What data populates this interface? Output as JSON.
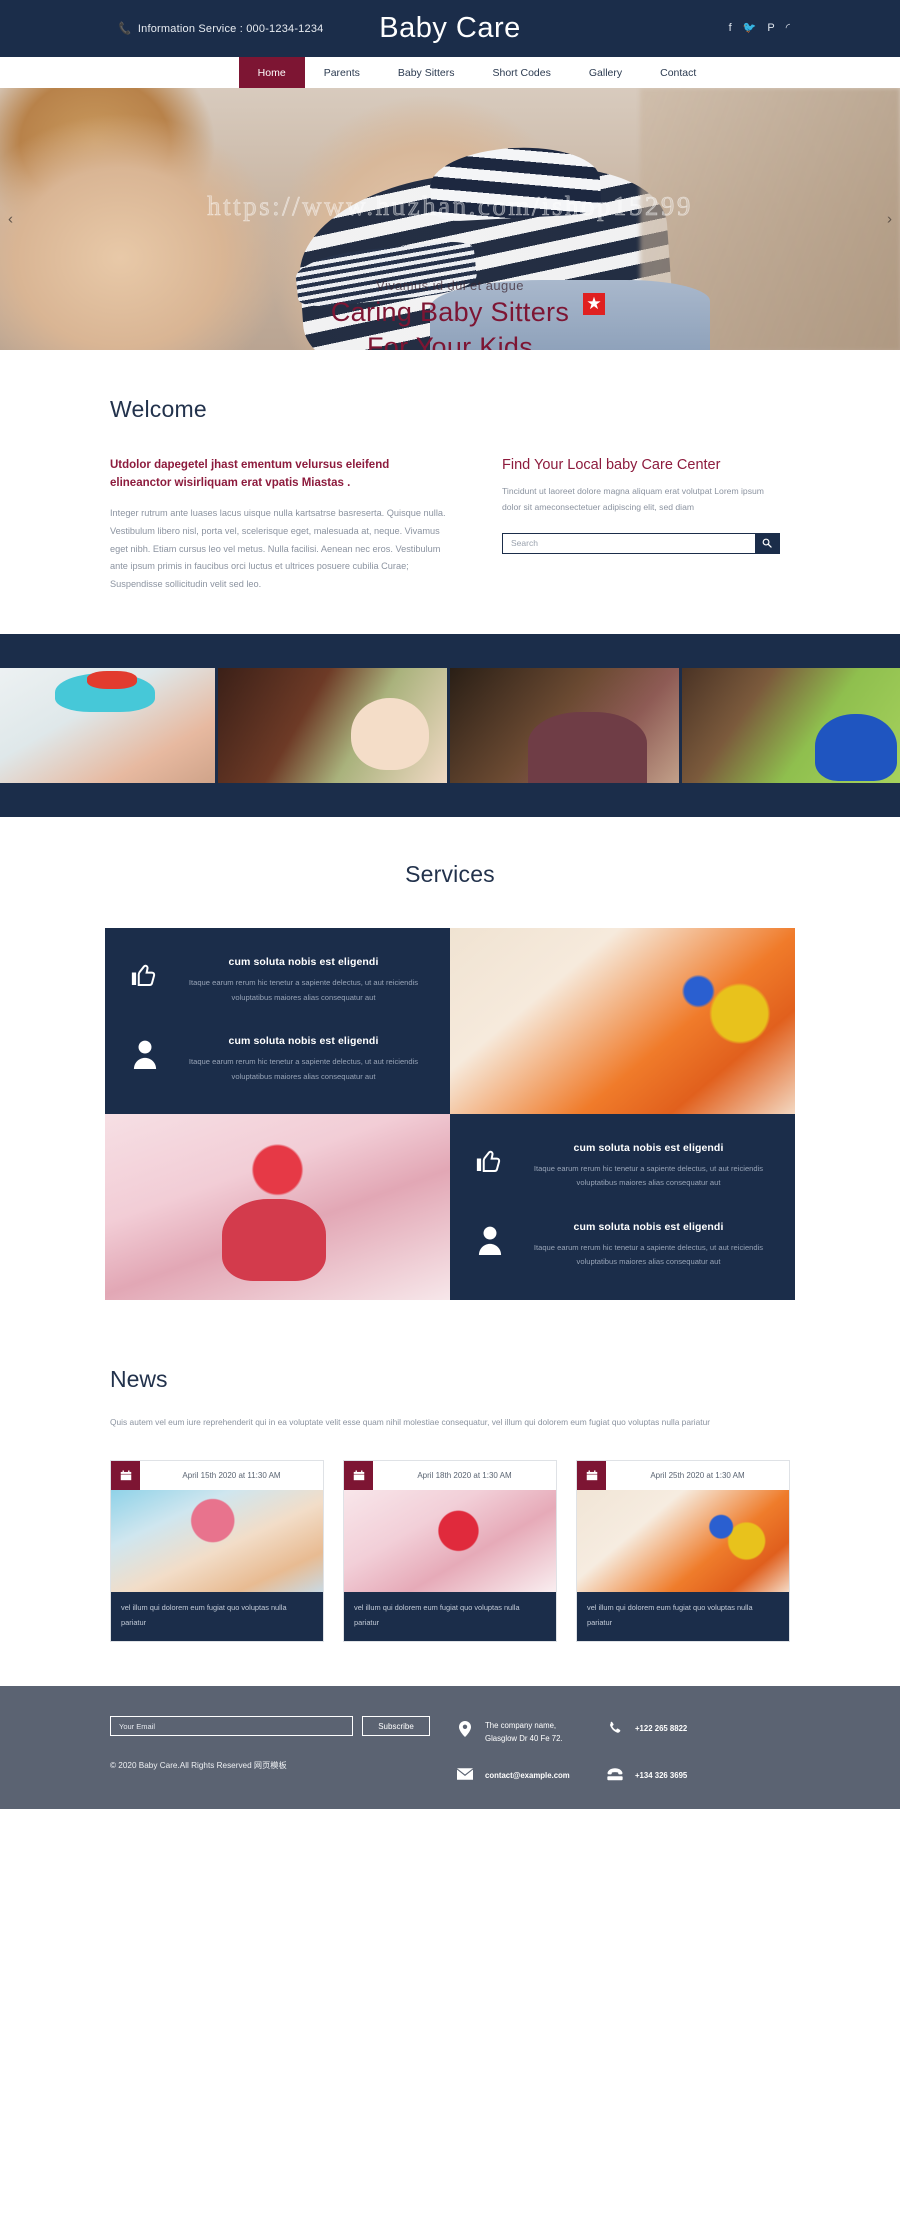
{
  "topbar": {
    "phone_icon": "phone-icon",
    "phone_label": "Information Service : 000-1234-1234",
    "brand": "Baby Care",
    "socials": [
      {
        "name": "facebook-icon",
        "glyph": "f"
      },
      {
        "name": "twitter-icon",
        "glyph": "🐦"
      },
      {
        "name": "pinterest-icon",
        "glyph": "P"
      },
      {
        "name": "rss-icon",
        "glyph": "◜"
      }
    ]
  },
  "nav": {
    "items": [
      {
        "label": "Home",
        "active": true
      },
      {
        "label": "Parents",
        "active": false
      },
      {
        "label": "Baby Sitters",
        "active": false
      },
      {
        "label": "Short Codes",
        "active": false
      },
      {
        "label": "Gallery",
        "active": false
      },
      {
        "label": "Contact",
        "active": false
      }
    ]
  },
  "hero": {
    "watermark": "https://www.huzhan.com/ishop15299",
    "subtitle": "Vivamus id dui et augue",
    "title_line1": "Caring Baby Sitters",
    "title_line2": "For Your Kids",
    "arrow_prev": "‹",
    "arrow_next": "›"
  },
  "welcome": {
    "heading": "Welcome",
    "lead": "Utdolor dapegetel jhast ementum velursus eleifend elineanctor wisirliquam erat vpatis Miastas .",
    "body": "Integer rutrum ante luases lacus uisque nulla kartsatrse basreserta. Quisque nulla. Vestibulum libero nisl, porta vel, scelerisque eget, malesuada at, neque. Vivamus eget nibh. Etiam cursus leo vel metus. Nulla facilisi. Aenean nec eros. Vestibulum ante ipsum primis in faucibus orci luctus et ultrices posuere cubilia Curae; Suspendisse sollicitudin velit sed leo.",
    "find_heading": "Find Your Local baby Care Center",
    "find_body": "Tincidunt ut laoreet dolore magna aliquam erat volutpat Lorem ipsum dolor sit ameconsectetuer adipiscing elit, sed diam",
    "search_placeholder": "Search",
    "search_value": "",
    "search_icon": "search-icon"
  },
  "gallery": {
    "items": [
      {
        "name": "gallery-photo-baby-blue-hat"
      },
      {
        "name": "gallery-photo-mother-and-baby"
      },
      {
        "name": "gallery-photo-father-carrying-child"
      },
      {
        "name": "gallery-photo-smiling-mother-baby"
      }
    ]
  },
  "services": {
    "heading": "Services",
    "cards": [
      {
        "icon": "thumbs-up-icon",
        "title": "cum soluta nobis est eligendi",
        "body": "Itaque earum rerum hic tenetur a sapiente delectus, ut aut reiciendis voluptatibus maiores alias consequatur aut"
      },
      {
        "icon": "user-icon",
        "title": "cum soluta nobis est eligendi",
        "body": "Itaque earum rerum hic tenetur a sapiente delectus, ut aut reiciendis voluptatibus maiores alias consequatur aut"
      },
      {
        "icon": "thumbs-up-icon",
        "title": "cum soluta nobis est eligendi",
        "body": "Itaque earum rerum hic tenetur a sapiente delectus, ut aut reiciendis voluptatibus maiores alias consequatur aut"
      },
      {
        "icon": "user-icon",
        "title": "cum soluta nobis est eligendi",
        "body": "Itaque earum rerum hic tenetur a sapiente delectus, ut aut reiciendis voluptatibus maiores alias consequatur aut"
      }
    ],
    "photo_top_right": "baby-hands-with-toy-photo",
    "photo_bottom_left": "baby-in-red-outfit-photo"
  },
  "news": {
    "heading": "News",
    "intro": "Quis autem vel eum iure reprehenderit qui in ea voluptate velit esse quam nihil molestiae consequatur, vel illum qui dolorem eum fugiat quo voluptas nulla pariatur",
    "calendar_icon": "calendar-icon",
    "cards": [
      {
        "date": "April 15th 2020 at 11:30 AM",
        "caption": "vel illum qui dolorem eum fugiat quo voluptas nulla pariatur"
      },
      {
        "date": "April 18th 2020 at 1:30 AM",
        "caption": "vel illum qui dolorem eum fugiat quo voluptas nulla pariatur"
      },
      {
        "date": "April 25th 2020 at 1:30 AM",
        "caption": "vel illum qui dolorem eum fugiat quo voluptas nulla pariatur"
      }
    ]
  },
  "footer": {
    "email_placeholder": "Your Email",
    "email_value": "",
    "subscribe_label": "Subscribe",
    "copyright": "© 2020 Baby Care.All Rights Reserved 网页模板",
    "address_line1": "The company name,",
    "address_line2": "Glasglow Dr 40 Fe 72.",
    "email": "contact@example.com",
    "phone_mobile": "+122 265 8822",
    "phone_landline": "+134 326 3695",
    "icons": {
      "location": "location-pin-icon",
      "envelope": "envelope-icon",
      "mobile": "mobile-phone-icon",
      "landline": "landline-phone-icon"
    }
  },
  "colors": {
    "navy": "#1b2d4a",
    "maroon": "#7d1533",
    "accent_text": "#8d1b3d",
    "footer_gray": "#5b6372",
    "muted": "#8b93a0"
  }
}
